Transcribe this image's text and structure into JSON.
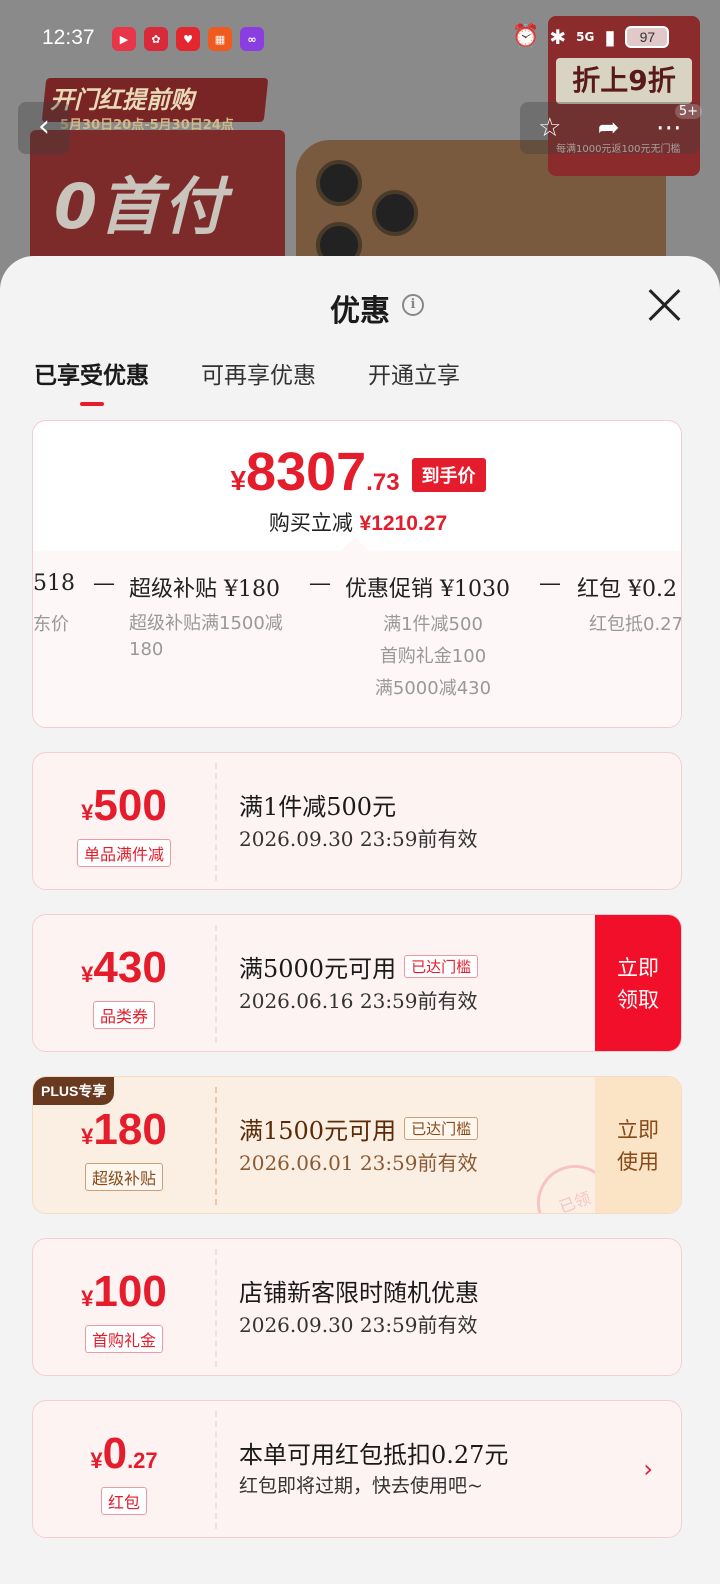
{
  "status": {
    "time": "12:37",
    "network": "5G",
    "battery": "97"
  },
  "backdrop": {
    "banner_title": "开门红提前购",
    "banner_date": "5月30日20点-5月30日24点",
    "big_text": "0首付",
    "corner_title": "折上9折",
    "corner_sub": "每满1000元返100元无门槛",
    "more_badge": "5+"
  },
  "sheet": {
    "title": "优惠",
    "tabs": [
      "已享受优惠",
      "可再享优惠",
      "开通立享"
    ],
    "summary": {
      "currency": "¥",
      "price_int": "8307",
      "price_dec": ".73",
      "price_tag": "到手价",
      "reduce_label": "购买立减",
      "reduce_amount": "¥1210.27",
      "breakdown": {
        "row": [
          "518",
          "—",
          "超级补贴 ¥180",
          "—",
          "优惠促销 ¥1030",
          "—",
          "红包 ¥0.2"
        ],
        "col1_sub": "东价",
        "col2_sub": [
          "超级补贴满1500减",
          "180"
        ],
        "col3_sub": [
          "满1件减500",
          "首购礼金100",
          "满5000减430"
        ],
        "col4_sub": "红包抵0.27"
      }
    },
    "coupons": [
      {
        "currency": "¥",
        "amount": "500",
        "amount_dec": "",
        "type": "单品满件减",
        "title": "满1件减500元",
        "chip": "",
        "expire": "2026.09.30 23:59前有效",
        "action": ""
      },
      {
        "currency": "¥",
        "amount": "430",
        "amount_dec": "",
        "type": "品类券",
        "title": "满5000元可用",
        "chip": "已达门槛",
        "expire": "2026.06.16 23:59前有效",
        "action": "立即领取"
      },
      {
        "currency": "¥",
        "amount": "180",
        "amount_dec": "",
        "type": "超级补贴",
        "title": "满1500元可用",
        "chip": "已达门槛",
        "expire": "2026.06.01 23:59前有效",
        "action": "立即使用",
        "badge": "PLUS专享",
        "stamp": "已领"
      },
      {
        "currency": "¥",
        "amount": "100",
        "amount_dec": "",
        "type": "首购礼金",
        "title": "店铺新客限时随机优惠",
        "chip": "",
        "expire": "2026.09.30 23:59前有效",
        "action": ""
      },
      {
        "currency": "¥",
        "amount": "0",
        "amount_dec": ".27",
        "type": "红包",
        "title": "本单可用红包抵扣0.27元",
        "chip": "",
        "expire": "红包即将过期，快去使用吧~",
        "action": ""
      }
    ]
  },
  "colors": {
    "accent": "#e41c2c",
    "plus_brown": "#8a4a18"
  }
}
